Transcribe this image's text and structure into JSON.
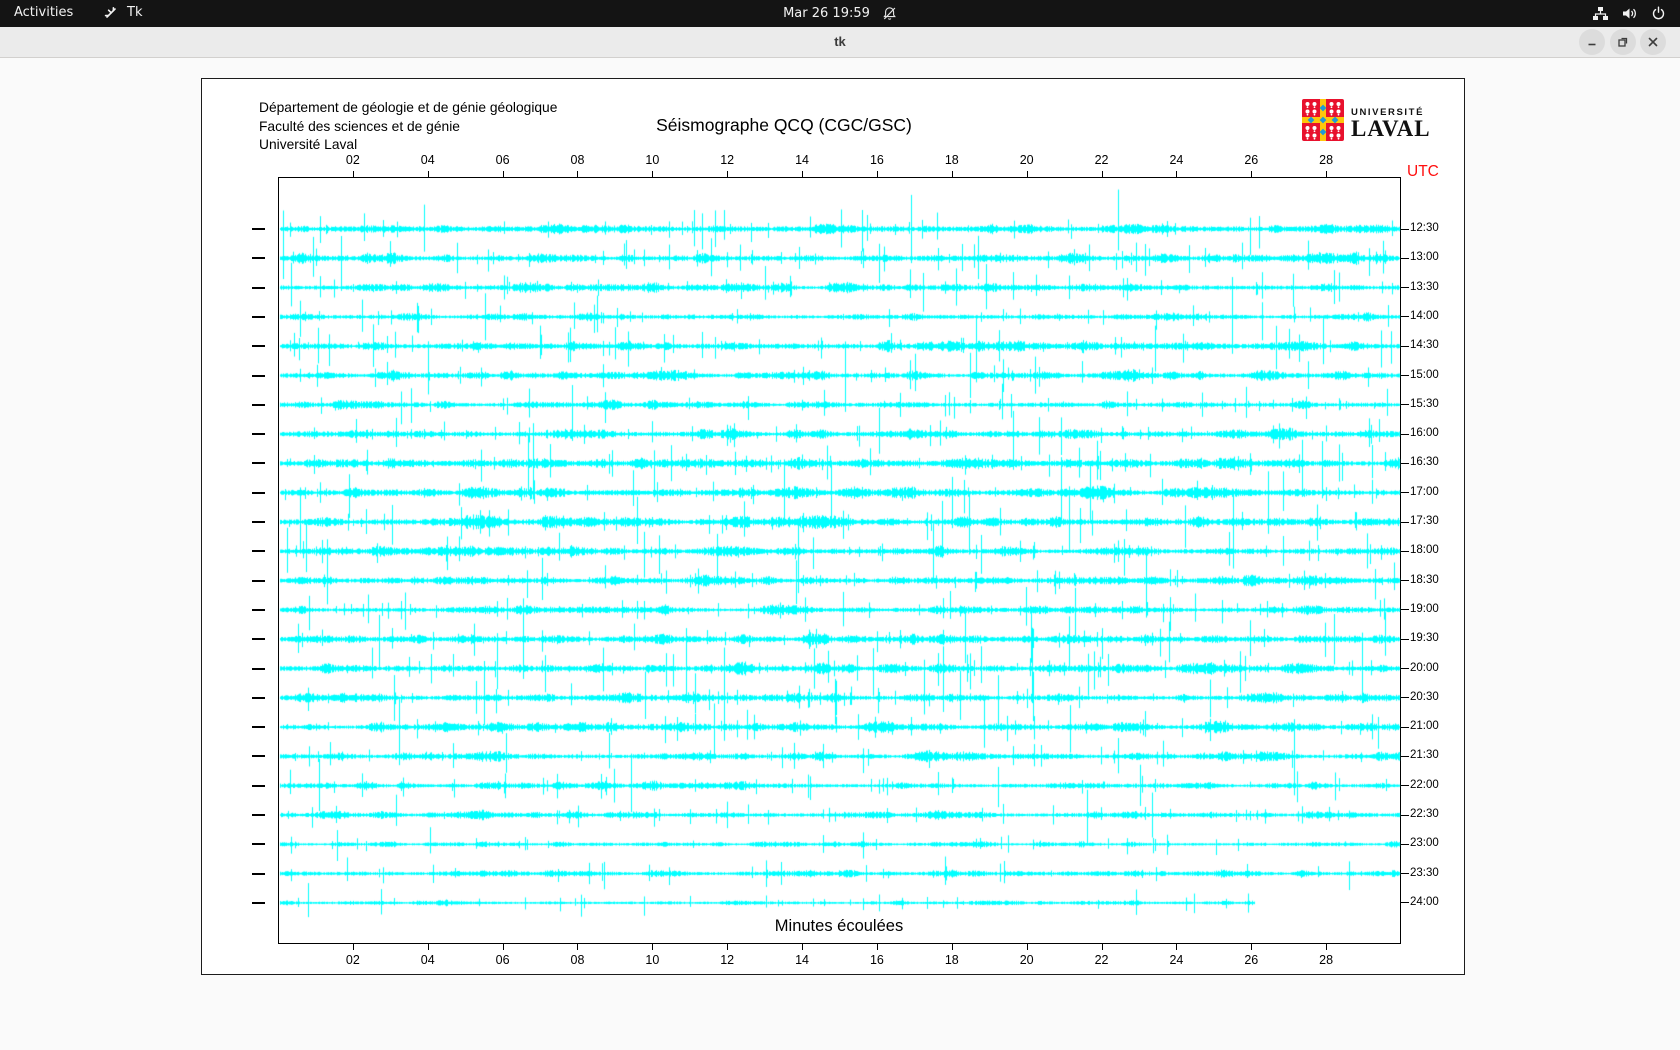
{
  "top_bar": {
    "activities": "Activities",
    "app_name": "Tk",
    "clock": "Mar 26 19:59",
    "icons": {
      "app": "tk-branch-glyph",
      "notifications": "bell-crossed",
      "network": "wired-network-tree",
      "volume": "speaker-with-waves",
      "power": "power-circle"
    }
  },
  "title_bar": {
    "title": "tk",
    "buttons": {
      "minimize": "minimize",
      "maximize": "restore",
      "close": "close"
    }
  },
  "canvas": {
    "header_lines": [
      "Département de géologie et de génie géologique",
      "Faculté des sciences et de génie",
      "Université Laval"
    ],
    "title": "Séismographe QCQ (CGC/GSC)",
    "logo": {
      "small": "UNIVERSITÉ",
      "large": "LAVAL"
    },
    "utc": "UTC",
    "xlabel": "Minutes écoulées"
  },
  "colors": {
    "accent_red": "#ff0f0f",
    "trace_cyan": "#00ffff",
    "logo_red": "#e8112d",
    "logo_yellow": "#ffc60b",
    "logo_blue": "#1f9ad6"
  },
  "chart_data": {
    "type": "line",
    "subtype": "helicorder-seismogram",
    "title": "Séismographe QCQ (CGC/GSC)",
    "xlabel": "Minutes écoulées",
    "ylabel_right": "UTC",
    "x_range_minutes": [
      0,
      30
    ],
    "x_ticks": [
      "02",
      "04",
      "06",
      "08",
      "10",
      "12",
      "14",
      "16",
      "18",
      "20",
      "22",
      "24",
      "26",
      "28"
    ],
    "grid": false,
    "legend": "none",
    "trace_color": "#00ffff",
    "rows": [
      {
        "label": "12:30",
        "seed": 101,
        "activity": 1.2,
        "coverage": 1.0
      },
      {
        "label": "13:00",
        "seed": 102,
        "activity": 1.15,
        "coverage": 1.0
      },
      {
        "label": "13:30",
        "seed": 103,
        "activity": 1.0,
        "coverage": 1.0
      },
      {
        "label": "14:00",
        "seed": 104,
        "activity": 0.95,
        "coverage": 1.0
      },
      {
        "label": "14:30",
        "seed": 105,
        "activity": 1.15,
        "coverage": 1.0
      },
      {
        "label": "15:00",
        "seed": 106,
        "activity": 1.0,
        "coverage": 1.0
      },
      {
        "label": "15:30",
        "seed": 107,
        "activity": 0.9,
        "coverage": 1.0
      },
      {
        "label": "16:00",
        "seed": 108,
        "activity": 1.05,
        "coverage": 1.0
      },
      {
        "label": "16:30",
        "seed": 109,
        "activity": 1.3,
        "coverage": 1.0
      },
      {
        "label": "17:00",
        "seed": 110,
        "activity": 1.2,
        "coverage": 1.0
      },
      {
        "label": "17:30",
        "seed": 111,
        "activity": 1.3,
        "coverage": 1.0
      },
      {
        "label": "18:00",
        "seed": 112,
        "activity": 1.15,
        "coverage": 1.0
      },
      {
        "label": "18:30",
        "seed": 113,
        "activity": 1.1,
        "coverage": 1.0
      },
      {
        "label": "19:00",
        "seed": 114,
        "activity": 1.0,
        "coverage": 1.0
      },
      {
        "label": "19:30",
        "seed": 115,
        "activity": 1.05,
        "coverage": 1.0
      },
      {
        "label": "20:00",
        "seed": 116,
        "activity": 1.2,
        "coverage": 1.0
      },
      {
        "label": "20:30",
        "seed": 117,
        "activity": 1.0,
        "coverage": 1.0
      },
      {
        "label": "21:00",
        "seed": 118,
        "activity": 1.05,
        "coverage": 1.0
      },
      {
        "label": "21:30",
        "seed": 119,
        "activity": 0.95,
        "coverage": 1.0
      },
      {
        "label": "22:00",
        "seed": 120,
        "activity": 0.9,
        "coverage": 1.0
      },
      {
        "label": "22:30",
        "seed": 121,
        "activity": 0.85,
        "coverage": 1.0
      },
      {
        "label": "23:00",
        "seed": 122,
        "activity": 0.6,
        "coverage": 1.0
      },
      {
        "label": "23:30",
        "seed": 123,
        "activity": 0.8,
        "coverage": 1.0
      },
      {
        "label": "24:00",
        "seed": 124,
        "activity": 0.55,
        "coverage": 0.87
      }
    ]
  }
}
